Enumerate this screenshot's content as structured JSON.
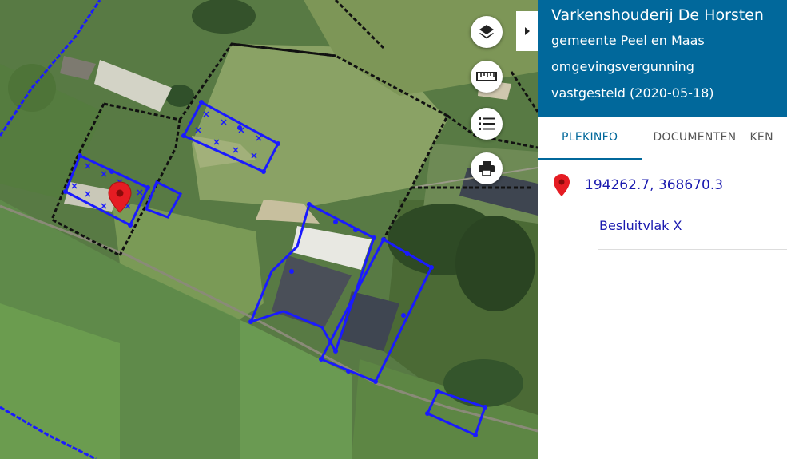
{
  "panel": {
    "title": "Varkenshouderij De Horsten",
    "municipality": "gemeente Peel en Maas",
    "type": "omgevingsvergunning",
    "status": "vastgesteld (2020-05-18)",
    "tabs": [
      "PLEKINFO",
      "DOCUMENTEN",
      "KEN"
    ],
    "coordinates": "194262.7, 368670.3",
    "feature_link": "Besluitvlak X"
  },
  "map_controls": [
    {
      "name": "layers-icon"
    },
    {
      "name": "ruler-icon"
    },
    {
      "name": "legend-list-icon"
    },
    {
      "name": "print-icon"
    }
  ],
  "colors": {
    "header_bg": "#01689b",
    "accent": "#01689b",
    "link": "#1a1aaf",
    "plan_outline": "#0000ff",
    "parcel_outline": "#111111",
    "marker": "#e51c23"
  }
}
